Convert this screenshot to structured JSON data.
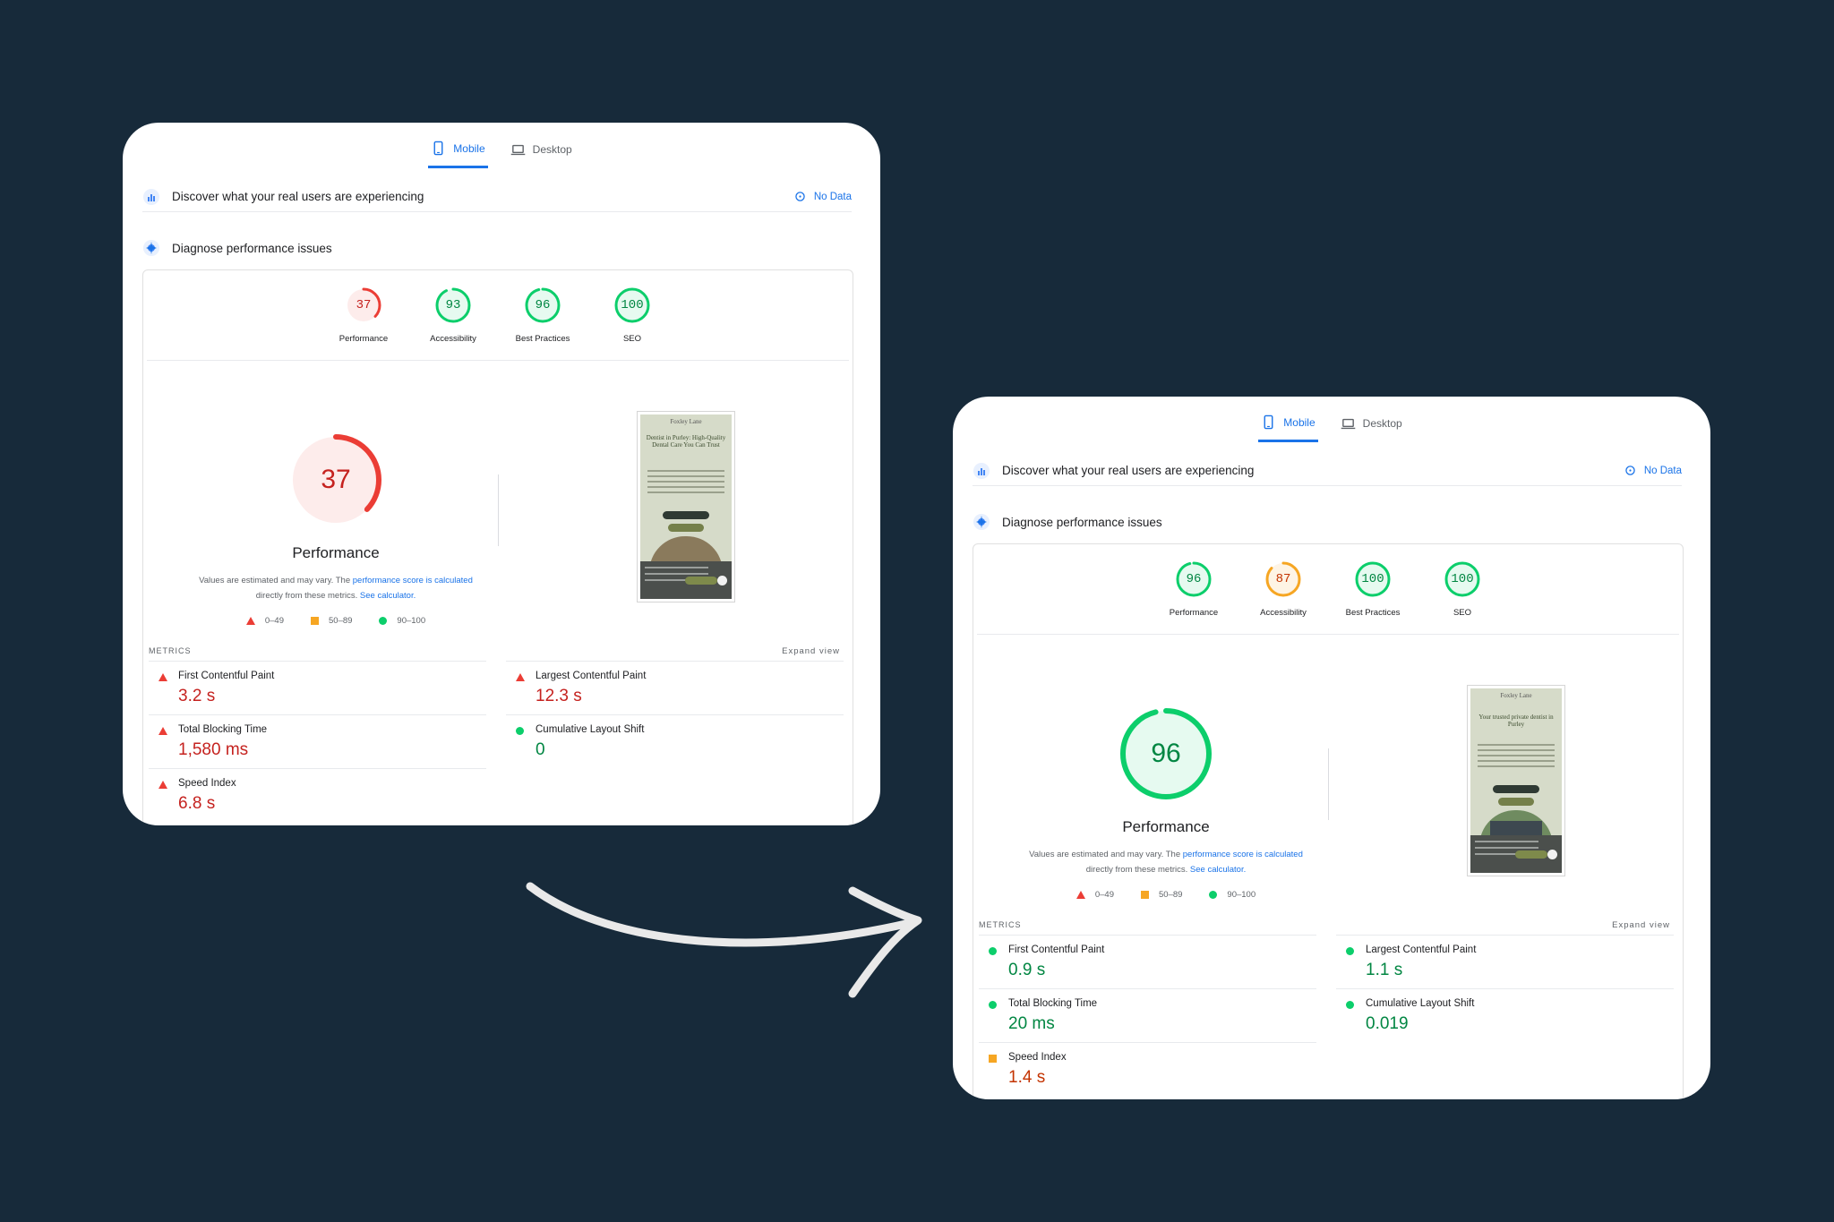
{
  "colors": {
    "background": "#172a3a",
    "poor": "#eb3d35",
    "average": "#f6a623",
    "good": "#0cce6b",
    "link": "#1a73e8"
  },
  "reports": [
    {
      "tabs": {
        "mobile": "Mobile",
        "desktop": "Desktop"
      },
      "field_data": {
        "title": "Discover what your real users are experiencing",
        "status": "No Data"
      },
      "lab_data": {
        "title": "Diagnose performance issues"
      },
      "scores": [
        {
          "label": "Performance",
          "value": 37,
          "rating": "poor"
        },
        {
          "label": "Accessibility",
          "value": 93,
          "rating": "good"
        },
        {
          "label": "Best Practices",
          "value": 96,
          "rating": "good"
        },
        {
          "label": "SEO",
          "value": 100,
          "rating": "good"
        }
      ],
      "main_gauge": {
        "value": 37,
        "rating": "poor",
        "label": "Performance",
        "note_prefix": "Values are estimated and may vary. The ",
        "note_link": "performance score is calculated",
        "note_middle": " directly from these metrics. ",
        "note_link2": "See calculator."
      },
      "legend": [
        "0–49",
        "50–89",
        "90–100"
      ],
      "screenshot": {
        "logo": "Foxley Lane",
        "headline": "Dentist in Purley: High-Quality Dental Care You Can Trust",
        "photo": "brown",
        "sign": ""
      },
      "metrics_title": "METRICS",
      "expand_label": "Expand view",
      "metrics": [
        {
          "name": "First Contentful Paint",
          "value": "3.2 s",
          "rating": "poor"
        },
        {
          "name": "Largest Contentful Paint",
          "value": "12.3 s",
          "rating": "poor"
        },
        {
          "name": "Total Blocking Time",
          "value": "1,580 ms",
          "rating": "poor"
        },
        {
          "name": "Cumulative Layout Shift",
          "value": "0",
          "rating": "good"
        },
        {
          "name": "Speed Index",
          "value": "6.8 s",
          "rating": "poor"
        }
      ]
    },
    {
      "tabs": {
        "mobile": "Mobile",
        "desktop": "Desktop"
      },
      "field_data": {
        "title": "Discover what your real users are experiencing",
        "status": "No Data"
      },
      "lab_data": {
        "title": "Diagnose performance issues"
      },
      "scores": [
        {
          "label": "Performance",
          "value": 96,
          "rating": "good"
        },
        {
          "label": "Accessibility",
          "value": 87,
          "rating": "average"
        },
        {
          "label": "Best Practices",
          "value": 100,
          "rating": "good"
        },
        {
          "label": "SEO",
          "value": 100,
          "rating": "good"
        }
      ],
      "main_gauge": {
        "value": 96,
        "rating": "good",
        "label": "Performance",
        "note_prefix": "Values are estimated and may vary. The ",
        "note_link": "performance score is calculated",
        "note_middle": " directly from these metrics. ",
        "note_link2": "See calculator."
      },
      "legend": [
        "0–49",
        "50–89",
        "90–100"
      ],
      "screenshot": {
        "logo": "Foxley Lane",
        "headline": "Your trusted private dentist in Purley",
        "photo": "leafy",
        "sign": "FoxleyLane"
      },
      "metrics_title": "METRICS",
      "expand_label": "Expand view",
      "metrics": [
        {
          "name": "First Contentful Paint",
          "value": "0.9 s",
          "rating": "good"
        },
        {
          "name": "Largest Contentful Paint",
          "value": "1.1 s",
          "rating": "good"
        },
        {
          "name": "Total Blocking Time",
          "value": "20 ms",
          "rating": "good"
        },
        {
          "name": "Cumulative Layout Shift",
          "value": "0.019",
          "rating": "good"
        },
        {
          "name": "Speed Index",
          "value": "1.4 s",
          "rating": "average"
        }
      ]
    }
  ]
}
